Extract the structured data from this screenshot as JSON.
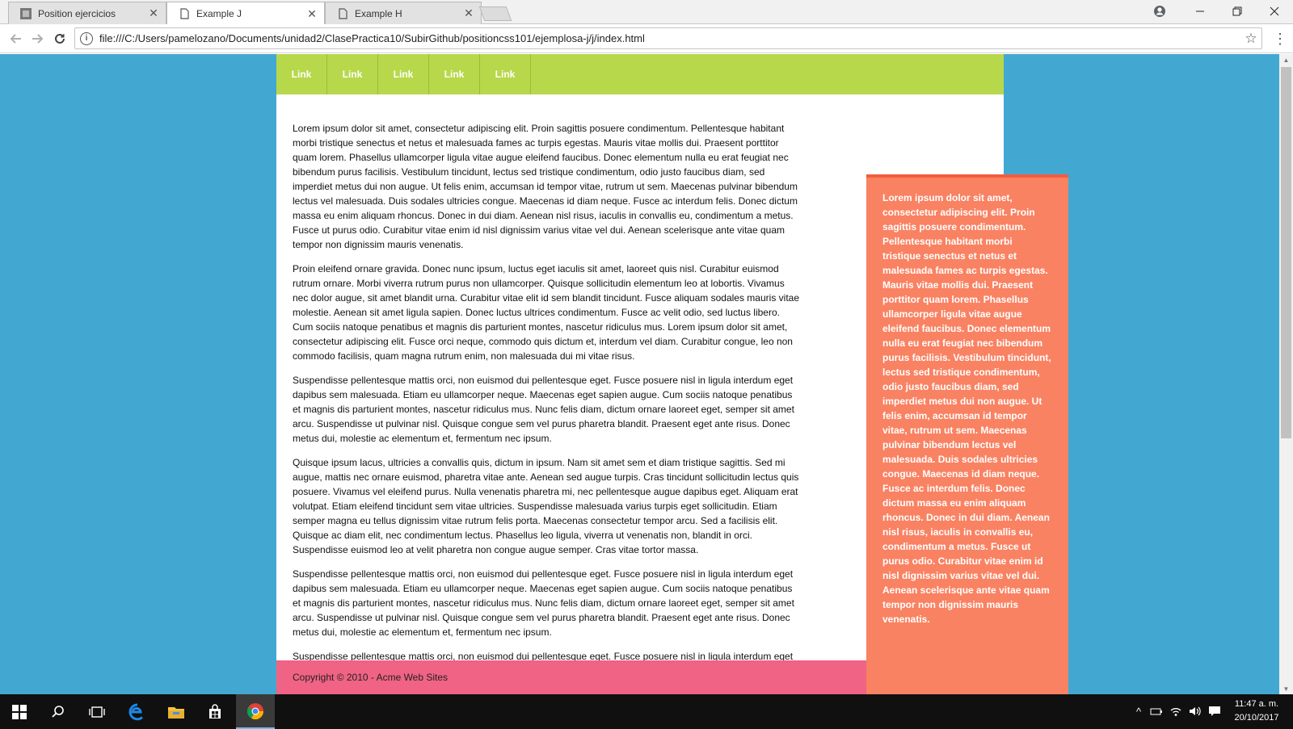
{
  "browser": {
    "tabs": [
      {
        "label": "Position ejercicios",
        "active": false
      },
      {
        "label": "Example J",
        "active": true
      },
      {
        "label": "Example H",
        "active": false
      }
    ],
    "url": "file:///C:/Users/pamelozano/Documents/unidad2/ClasePractica10/SubirGithub/positioncss101/ejemplosa-j/j/index.html"
  },
  "page": {
    "nav_links": [
      "Link",
      "Link",
      "Link",
      "Link",
      "Link"
    ],
    "paragraphs": [
      "Lorem ipsum dolor sit amet, consectetur adipiscing elit. Proin sagittis posuere condimentum. Pellentesque habitant morbi tristique senectus et netus et malesuada fames ac turpis egestas. Mauris vitae mollis dui. Praesent porttitor quam lorem. Phasellus ullamcorper ligula vitae augue eleifend faucibus. Donec elementum nulla eu erat feugiat nec bibendum purus facilisis. Vestibulum tincidunt, lectus sed tristique condimentum, odio justo faucibus diam, sed imperdiet metus dui non augue. Ut felis enim, accumsan id tempor vitae, rutrum ut sem. Maecenas pulvinar bibendum lectus vel malesuada. Duis sodales ultricies congue. Maecenas id diam neque. Fusce ac interdum felis. Donec dictum massa eu enim aliquam rhoncus. Donec in dui diam. Aenean nisl risus, iaculis in convallis eu, condimentum a metus. Fusce ut purus odio. Curabitur vitae enim id nisl dignissim varius vitae vel dui. Aenean scelerisque ante vitae quam tempor non dignissim mauris venenatis.",
      "Proin eleifend ornare gravida. Donec nunc ipsum, luctus eget iaculis sit amet, laoreet quis nisl. Curabitur euismod rutrum ornare. Morbi viverra rutrum purus non ullamcorper. Quisque sollicitudin elementum leo at lobortis. Vivamus nec dolor augue, sit amet blandit urna. Curabitur vitae elit id sem blandit tincidunt. Fusce aliquam sodales mauris vitae molestie. Aenean sit amet ligula sapien. Donec luctus ultrices condimentum. Fusce ac velit odio, sed luctus libero. Cum sociis natoque penatibus et magnis dis parturient montes, nascetur ridiculus mus. Lorem ipsum dolor sit amet, consectetur adipiscing elit. Fusce orci neque, commodo quis dictum et, interdum vel diam. Curabitur congue, leo non commodo facilisis, quam magna rutrum enim, non malesuada dui mi vitae risus.",
      "Suspendisse pellentesque mattis orci, non euismod dui pellentesque eget. Fusce posuere nisl in ligula interdum eget dapibus sem malesuada. Etiam eu ullamcorper neque. Maecenas eget sapien augue. Cum sociis natoque penatibus et magnis dis parturient montes, nascetur ridiculus mus. Nunc felis diam, dictum ornare laoreet eget, semper sit amet arcu. Suspendisse ut pulvinar nisl. Quisque congue sem vel purus pharetra blandit. Praesent eget ante risus. Donec metus dui, molestie ac elementum et, fermentum nec ipsum.",
      "Quisque ipsum lacus, ultricies a convallis quis, dictum in ipsum. Nam sit amet sem et diam tristique sagittis. Sed mi augue, mattis nec ornare euismod, pharetra vitae ante. Aenean sed augue turpis. Cras tincidunt sollicitudin lectus quis posuere. Vivamus vel eleifend purus. Nulla venenatis pharetra mi, nec pellentesque augue dapibus eget. Aliquam erat volutpat. Etiam eleifend tincidunt sem vitae ultricies. Suspendisse malesuada varius turpis eget sollicitudin. Etiam semper magna eu tellus dignissim vitae rutrum felis porta. Maecenas consectetur tempor arcu. Sed a facilisis elit. Quisque ac diam elit, nec condimentum lectus. Phasellus leo ligula, viverra ut venenatis non, blandit in orci. Suspendisse euismod leo at velit pharetra non congue augue semper. Cras vitae tortor massa.",
      "Suspendisse pellentesque mattis orci, non euismod dui pellentesque eget. Fusce posuere nisl in ligula interdum eget dapibus sem malesuada. Etiam eu ullamcorper neque. Maecenas eget sapien augue. Cum sociis natoque penatibus et magnis dis parturient montes, nascetur ridiculus mus. Nunc felis diam, dictum ornare laoreet eget, semper sit amet arcu. Suspendisse ut pulvinar nisl. Quisque congue sem vel purus pharetra blandit. Praesent eget ante risus. Donec metus dui, molestie ac elementum et, fermentum nec ipsum.",
      "Suspendisse pellentesque mattis orci, non euismod dui pellentesque eget. Fusce posuere nisl in ligula interdum eget"
    ],
    "sidebar_text": "Lorem ipsum dolor sit amet, consectetur adipiscing elit. Proin sagittis posuere condimentum. Pellentesque habitant morbi tristique senectus et netus et malesuada fames ac turpis egestas. Mauris vitae mollis dui. Praesent porttitor quam lorem. Phasellus ullamcorper ligula vitae augue eleifend faucibus. Donec elementum nulla eu erat feugiat nec bibendum purus facilisis. Vestibulum tincidunt, lectus sed tristique condimentum, odio justo faucibus diam, sed imperdiet metus dui non augue. Ut felis enim, accumsan id tempor vitae, rutrum ut sem. Maecenas pulvinar bibendum lectus vel malesuada. Duis sodales ultricies congue. Maecenas id diam neque. Fusce ac interdum felis. Donec dictum massa eu enim aliquam rhoncus. Donec in dui diam. Aenean nisl risus, iaculis in convallis eu, condimentum a metus. Fusce ut purus odio. Curabitur vitae enim id nisl dignissim varius vitae vel dui. Aenean scelerisque ante vitae quam tempor non dignissim mauris venenatis.",
    "footer": "Copyright © 2010 - Acme Web Sites"
  },
  "taskbar": {
    "clock_time": "11:47 a. m.",
    "clock_date": "20/10/2017"
  },
  "colors": {
    "page_background": "#43a8d1",
    "nav_background": "#b8d84c",
    "sidebar_background": "#f98262",
    "sidebar_border": "#f45c3e",
    "footer_background": "#f06384"
  },
  "icons": {
    "back": "arrow-left-icon",
    "forward": "arrow-right-icon",
    "reload": "reload-icon",
    "info": "info-icon",
    "bookmark": "star-icon",
    "menu": "kebab-menu-icon",
    "profile": "profile-icon",
    "start": "windows-start-icon",
    "search": "search-icon",
    "task_view": "task-view-icon",
    "edge": "edge-icon",
    "explorer": "file-explorer-icon",
    "store": "store-icon",
    "chrome": "chrome-icon"
  }
}
